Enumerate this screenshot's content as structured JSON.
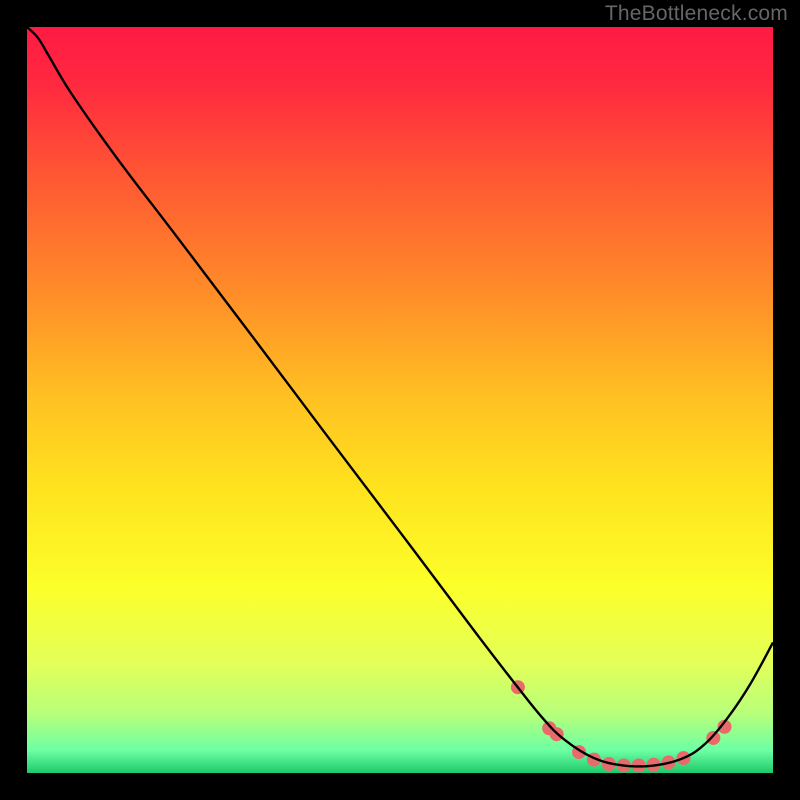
{
  "watermark": "TheBottleneck.com",
  "chart_data": {
    "type": "line",
    "title": "",
    "xlabel": "",
    "ylabel": "",
    "xlim": [
      0,
      1
    ],
    "ylim": [
      0,
      1
    ],
    "background_gradient": {
      "stops": [
        {
          "offset": 0.0,
          "color": "#ff1a44"
        },
        {
          "offset": 0.08,
          "color": "#ff2a3f"
        },
        {
          "offset": 0.2,
          "color": "#ff5733"
        },
        {
          "offset": 0.35,
          "color": "#ff8a29"
        },
        {
          "offset": 0.5,
          "color": "#ffc222"
        },
        {
          "offset": 0.62,
          "color": "#ffe31e"
        },
        {
          "offset": 0.75,
          "color": "#fcff2a"
        },
        {
          "offset": 0.85,
          "color": "#e4ff57"
        },
        {
          "offset": 0.92,
          "color": "#b8ff7a"
        },
        {
          "offset": 0.97,
          "color": "#6cffa3"
        },
        {
          "offset": 1.0,
          "color": "#1cc96a"
        }
      ]
    },
    "series": [
      {
        "name": "curve",
        "color": "#000000",
        "x": [
          0.0,
          0.015,
          0.03,
          0.06,
          0.12,
          0.2,
          0.3,
          0.4,
          0.5,
          0.6,
          0.65,
          0.69,
          0.72,
          0.76,
          0.8,
          0.84,
          0.88,
          0.91,
          0.94,
          0.97,
          1.0
        ],
        "y": [
          1.0,
          0.985,
          0.96,
          0.91,
          0.825,
          0.72,
          0.588,
          0.455,
          0.323,
          0.19,
          0.125,
          0.075,
          0.045,
          0.02,
          0.01,
          0.01,
          0.02,
          0.04,
          0.075,
          0.12,
          0.175
        ]
      }
    ],
    "markers": {
      "name": "dots",
      "color": "#e86a6a",
      "radius": 7,
      "x": [
        0.658,
        0.7,
        0.71,
        0.74,
        0.76,
        0.78,
        0.8,
        0.82,
        0.84,
        0.86,
        0.88,
        0.92,
        0.935
      ],
      "y": [
        0.115,
        0.06,
        0.052,
        0.028,
        0.018,
        0.012,
        0.01,
        0.01,
        0.011,
        0.014,
        0.02,
        0.047,
        0.062
      ]
    }
  }
}
